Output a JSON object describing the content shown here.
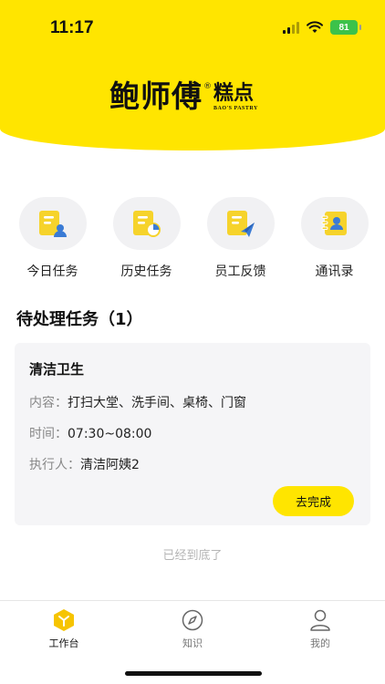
{
  "status_bar": {
    "time": "11:17",
    "battery": "81"
  },
  "brand": {
    "name": "鲍师傅",
    "registered": "®",
    "sub": "糕点",
    "english": "BAO'S PASTRY"
  },
  "entries": [
    {
      "label": "今日任务",
      "icon": "today-task-icon"
    },
    {
      "label": "历史任务",
      "icon": "history-task-icon"
    },
    {
      "label": "员工反馈",
      "icon": "feedback-icon"
    },
    {
      "label": "通讯录",
      "icon": "contacts-icon"
    }
  ],
  "pending": {
    "title": "待处理任务（1）",
    "tasks": [
      {
        "name": "清洁卫生",
        "content_label": "内容：",
        "content": "打扫大堂、洗手间、桌椅、门窗",
        "time_label": "时间：",
        "time": "07:30~08:00",
        "executor_label": "执行人：",
        "executor": "清洁阿姨2",
        "action": "去完成"
      }
    ],
    "end_tip": "已经到底了"
  },
  "tabbar": [
    {
      "label": "工作台",
      "icon": "workbench-icon",
      "active": true
    },
    {
      "label": "知识",
      "icon": "compass-icon",
      "active": false
    },
    {
      "label": "我的",
      "icon": "user-icon",
      "active": false
    }
  ],
  "colors": {
    "brand_yellow": "#ffe500",
    "card_bg": "#f5f5f7",
    "icon_yellow": "#f6d32b",
    "icon_blue": "#3a7bd5"
  }
}
